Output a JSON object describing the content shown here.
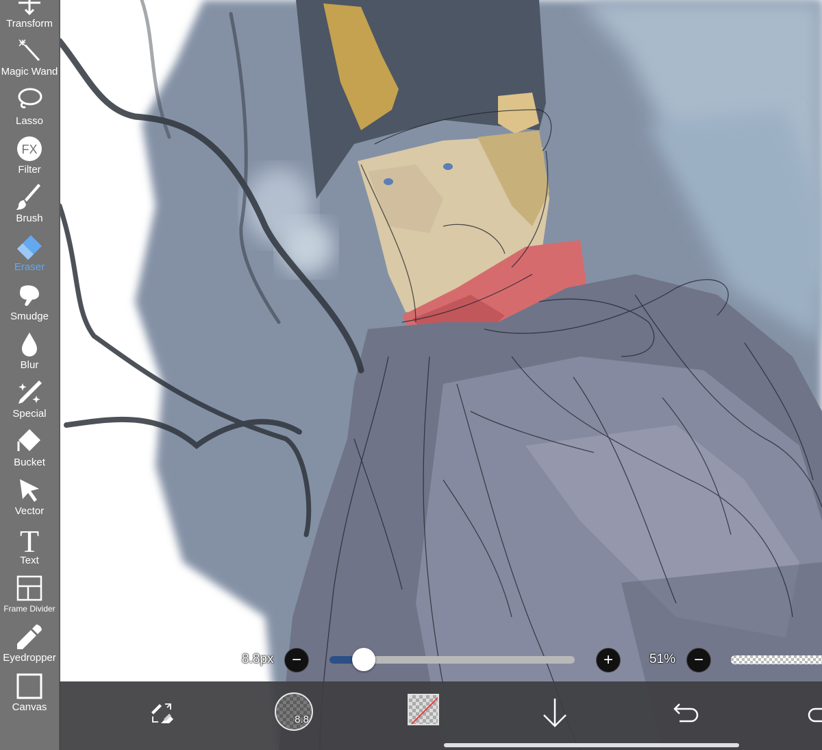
{
  "app": {
    "accent_color": "#64a8f0",
    "toolbar_bg": "#737373"
  },
  "toolbar": {
    "items": [
      {
        "label": "Transform",
        "icon": "move-arrows-icon",
        "active": false
      },
      {
        "label": "Magic Wand",
        "icon": "magic-wand-icon",
        "active": false
      },
      {
        "label": "Lasso",
        "icon": "lasso-icon",
        "active": false
      },
      {
        "label": "Filter",
        "icon": "fx-icon",
        "active": false
      },
      {
        "label": "Brush",
        "icon": "brush-icon",
        "active": false
      },
      {
        "label": "Eraser",
        "icon": "eraser-icon",
        "active": true
      },
      {
        "label": "Smudge",
        "icon": "smudge-icon",
        "active": false
      },
      {
        "label": "Blur",
        "icon": "droplet-icon",
        "active": false
      },
      {
        "label": "Special",
        "icon": "sparkle-pen-icon",
        "active": false
      },
      {
        "label": "Bucket",
        "icon": "bucket-icon",
        "active": false
      },
      {
        "label": "Vector",
        "icon": "cursor-arrow-icon",
        "active": false
      },
      {
        "label": "Text",
        "icon": "text-t-icon",
        "active": false
      },
      {
        "label": "Frame Divider",
        "icon": "frame-divider-icon",
        "active": false
      },
      {
        "label": "Eyedropper",
        "icon": "eyedropper-icon",
        "active": false
      },
      {
        "label": "Canvas",
        "icon": "canvas-square-icon",
        "active": false
      }
    ]
  },
  "brush_controls": {
    "size_label": "8.8px",
    "size_slider_fraction": 0.14,
    "minus_symbol": "−",
    "plus_symbol": "+",
    "opacity_label": "51%"
  },
  "bottom_bar": {
    "brush_size_preview": "8.8",
    "primary_color": "transparent",
    "icons": [
      "swap-brush-eraser-icon",
      "brush-preview",
      "color-swatch",
      "down-arrow-icon",
      "undo-icon",
      "redo-icon"
    ]
  }
}
